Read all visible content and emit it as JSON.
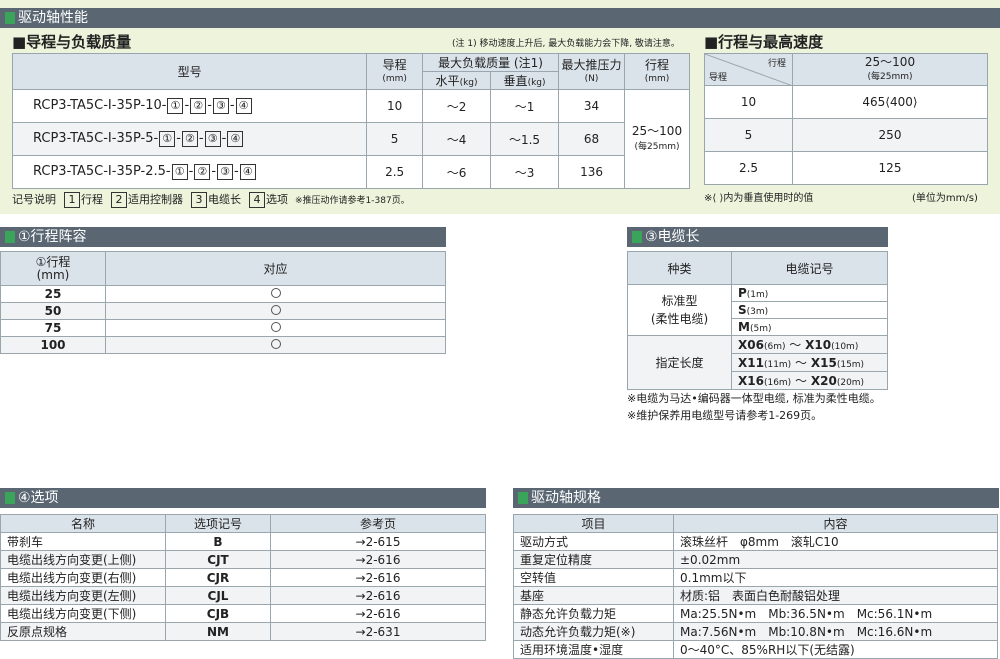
{
  "top_section": {
    "title": "驱动轴性能"
  },
  "lead_load": {
    "title": "■导程与负载质量",
    "note": "(注 1) 移动速度上升后, 最大负载能力会下降, 敬请注意。",
    "headers": {
      "model": "型号",
      "lead": "导程",
      "lead_unit": "(mm)",
      "max_load": "最大负载质量 (注1)",
      "horizontal": "水平",
      "vertical": "垂直",
      "kg": "(kg)",
      "thrust": "最大推压力",
      "thrust_unit": "(N)",
      "stroke": "行程",
      "stroke_unit": "(mm)"
    },
    "rows": [
      {
        "model": "RCP3-TA5C-I-35P-10-",
        "lead": "10",
        "h": "～2",
        "v": "～1",
        "thrust": "34"
      },
      {
        "model": "RCP3-TA5C-I-35P-5-",
        "lead": "5",
        "h": "～4",
        "v": "～1.5",
        "thrust": "68"
      },
      {
        "model": "RCP3-TA5C-I-35P-2.5-",
        "lead": "2.5",
        "h": "～6",
        "v": "～3",
        "thrust": "136"
      }
    ],
    "stroke_value": "25～100",
    "stroke_sub": "(每25mm)",
    "boxes": [
      "①",
      "②",
      "③",
      "④"
    ],
    "legend": {
      "label": "记号说明",
      "items": [
        {
          "box": "1",
          "text": "行程"
        },
        {
          "box": "2",
          "text": "适用控制器"
        },
        {
          "box": "3",
          "text": "电缆长"
        },
        {
          "box": "4",
          "text": "选项"
        }
      ],
      "extra": "※推压动作请参考1-387页。"
    }
  },
  "speed": {
    "title": "■行程与最高速度",
    "corner_top": "行程",
    "corner_bottom": "导程",
    "col": "25～100",
    "col_sub": "(每25mm)",
    "rows": [
      {
        "lead": "10",
        "speed": "465⟨400⟩"
      },
      {
        "lead": "5",
        "speed": "250"
      },
      {
        "lead": "2.5",
        "speed": "125"
      }
    ],
    "note": "※⟨ ⟩内为垂直使用时的值",
    "unit": "(单位为mm/s)"
  },
  "stroke_list": {
    "title": "①行程阵容",
    "h1": "①行程",
    "h1u": "(mm)",
    "h2": "对应",
    "rows": [
      "25",
      "50",
      "75",
      "100"
    ]
  },
  "cable": {
    "title": "③电缆长",
    "h1": "种类",
    "h2": "电缆记号",
    "std_label1": "标准型",
    "std_label2": "(柔性电缆)",
    "std": [
      {
        "k": "P",
        "v": "(1m)"
      },
      {
        "k": "S",
        "v": "(3m)"
      },
      {
        "k": "M",
        "v": "(5m)"
      }
    ],
    "custom_label": "指定长度",
    "custom": [
      {
        "a": "X06",
        "av": "(6m)",
        "b": "X10",
        "bv": "(10m)"
      },
      {
        "a": "X11",
        "av": "(11m)",
        "b": "X15",
        "bv": "(15m)"
      },
      {
        "a": "X16",
        "av": "(16m)",
        "b": "X20",
        "bv": "(20m)"
      }
    ],
    "tilde": "～",
    "note1": "※电缆为马达•编码器一体型电缆, 标准为柔性电缆。",
    "note2": "※维护保养用电缆型号请参考1-269页。"
  },
  "options": {
    "title": "④选项",
    "headers": [
      "名称",
      "选项记号",
      "参考页"
    ],
    "rows": [
      [
        "带刹车",
        "B",
        "→2-615"
      ],
      [
        "电缆出线方向变更(上侧)",
        "CJT",
        "→2-616"
      ],
      [
        "电缆出线方向变更(右侧)",
        "CJR",
        "→2-616"
      ],
      [
        "电缆出线方向变更(左侧)",
        "CJL",
        "→2-616"
      ],
      [
        "电缆出线方向变更(下侧)",
        "CJB",
        "→2-616"
      ],
      [
        "反原点规格",
        "NM",
        "→2-631"
      ]
    ]
  },
  "spec": {
    "title": "驱动轴规格",
    "headers": [
      "项目",
      "内容"
    ],
    "rows": [
      [
        "驱动方式",
        "滚珠丝杆　φ8mm　滚轧C10"
      ],
      [
        "重复定位精度",
        "±0.02mm"
      ],
      [
        "空转值",
        "0.1mm以下"
      ],
      [
        "基座",
        "材质:铝　表面白色耐酸铝处理"
      ],
      [
        "静态允许负载力矩",
        "Ma:25.5N•m　Mb:36.5N•m　Mc:56.1N•m"
      ],
      [
        "动态允许负载力矩(※)",
        "Ma:7.56N•m　Mb:10.8N•m　Mc:16.6N•m"
      ],
      [
        "适用环境温度•湿度",
        "0～40°C、85%RH以下(无结露)"
      ]
    ]
  }
}
